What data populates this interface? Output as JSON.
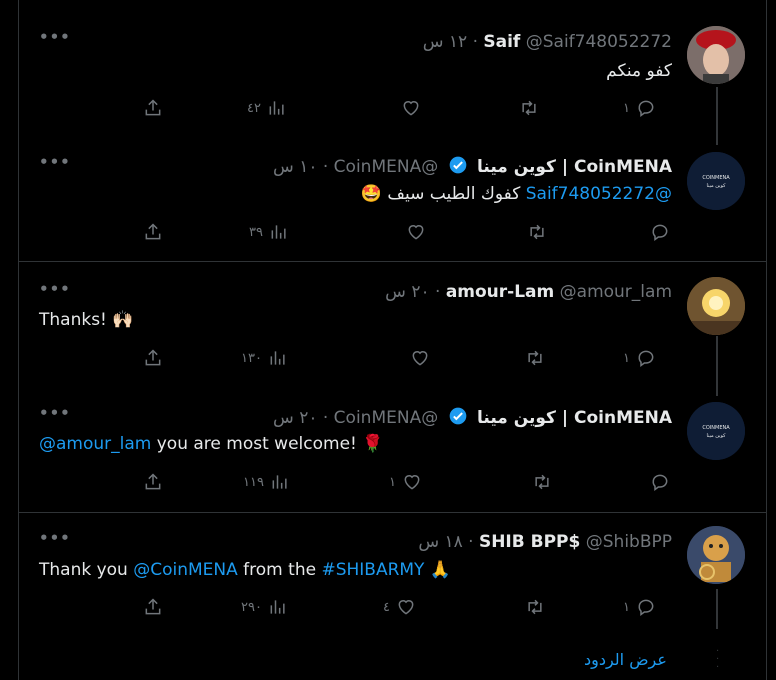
{
  "tweets": [
    {
      "name": "Saif",
      "handle": "@Saif748052272",
      "time": "١٢ س",
      "sep": "·",
      "text": "كفو منكم",
      "views": "٤٢",
      "likes": "",
      "retweets": "",
      "replies": "١"
    },
    {
      "name": "CoinMENA | كوين مينا",
      "handle": "@CoinMENA",
      "time": "١٠ س",
      "sep": "·",
      "mention": "@Saif748052272",
      "text": " كفوك الطيب سيف ",
      "emoji": "🤩",
      "views": "٣٩",
      "likes": "",
      "retweets": "",
      "replies": ""
    },
    {
      "name": "amour-Lam",
      "handle": "@amour_lam",
      "time": "٢٠ س",
      "sep": "·",
      "text": "Thanks! ",
      "emoji": "🙌🏻",
      "views": "١٣٠",
      "likes": "",
      "retweets": "",
      "replies": "١"
    },
    {
      "name": "CoinMENA | كوين مينا",
      "handle": "@CoinMENA",
      "time": "٢٠ س",
      "sep": "·",
      "mention": "@amour_lam",
      "text": " you are most welcome! ",
      "emoji": "🌹",
      "views": "١١٩",
      "likes": "١",
      "retweets": "",
      "replies": ""
    },
    {
      "name": "SHIB BPP$",
      "handle": "@ShibBPP",
      "time": "١٨ س",
      "sep": "·",
      "text_a": "Thank you ",
      "mention": "@CoinMENA",
      "text_b": " from the ",
      "hashtag": "#SHIBARMY",
      "emoji": " 🙏",
      "views": "٢٩٠",
      "likes": "٤",
      "retweets": "",
      "replies": "١"
    }
  ],
  "show_replies_label": "عرض الردود",
  "colors": {
    "background": "#000000",
    "text": "#e7e9ea",
    "muted": "#71767b",
    "link": "#1d9bf0",
    "divider": "#2f3336",
    "verified": "#1d9bf0"
  },
  "icons": [
    "more-icon",
    "verified-badge-icon",
    "share-icon",
    "views-icon",
    "like-icon",
    "retweet-icon",
    "reply-icon"
  ],
  "coinmena_logo_text": "COINMENA كوين مينا"
}
